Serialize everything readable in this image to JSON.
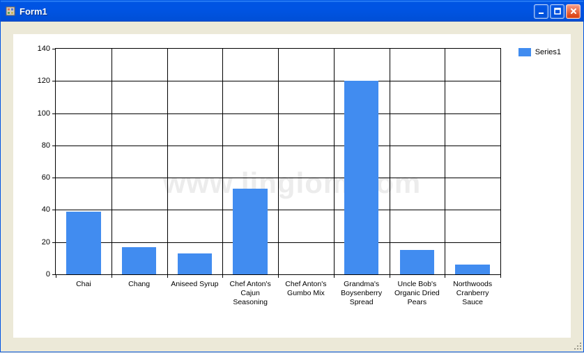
{
  "window": {
    "title": "Form1"
  },
  "watermark": "www.linglom.com",
  "legend": {
    "series_label": "Series1"
  },
  "chart_data": {
    "type": "bar",
    "title": "",
    "xlabel": "",
    "ylabel": "",
    "ylim": [
      0,
      140
    ],
    "yticks": [
      0,
      20,
      40,
      60,
      80,
      100,
      120,
      140
    ],
    "grid": {
      "x": true,
      "y": true
    },
    "legend_position": "right",
    "categories": [
      "Chai",
      "Chang",
      "Aniseed Syrup",
      "Chef Anton's Cajun Seasoning",
      "Chef Anton's Gumbo Mix",
      "Grandma's Boysenberry Spread",
      "Uncle Bob's Organic Dried Pears",
      "Northwoods Cranberry Sauce"
    ],
    "series": [
      {
        "name": "Series1",
        "color": "#418cf0",
        "values": [
          39,
          17,
          13,
          53,
          0,
          120,
          15,
          6
        ]
      }
    ]
  }
}
